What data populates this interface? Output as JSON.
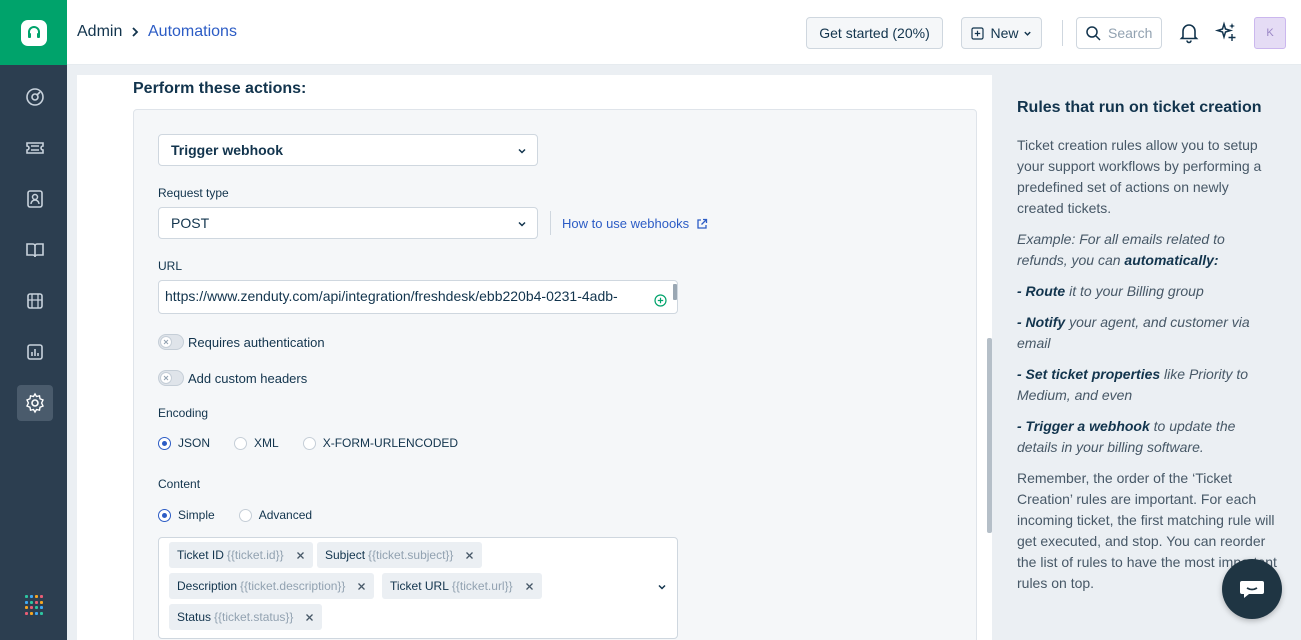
{
  "header": {
    "breadcrumb_root": "Admin",
    "breadcrumb_current": "Automations",
    "get_started_label": "Get started (20%)",
    "new_label": "New",
    "search_placeholder": "Search",
    "avatar_initial": "K"
  },
  "rail": {
    "items": [
      "dashboard-icon",
      "tickets-icon",
      "contacts-icon",
      "solutions-icon",
      "forums-icon",
      "reports-icon",
      "admin-gear-icon"
    ],
    "active": "admin-gear-icon",
    "brand_color": "#00a36b"
  },
  "main": {
    "section_title": "Perform these actions:",
    "action_select": "Trigger webhook",
    "request_type_label": "Request type",
    "request_type_value": "POST",
    "how_to_link": "How to use webhooks",
    "url_label": "URL",
    "url_value": "https://www.zenduty.com/api/integration/freshdesk/ebb220b4-0231-4adb-",
    "requires_auth_label": "Requires authentication",
    "requires_auth_on": false,
    "custom_headers_label": "Add custom headers",
    "custom_headers_on": false,
    "encoding_label": "Encoding",
    "encoding_options": [
      "JSON",
      "XML",
      "X-FORM-URLENCODED"
    ],
    "encoding_selected": "JSON",
    "content_label": "Content",
    "content_options": [
      "Simple",
      "Advanced"
    ],
    "content_selected": "Simple",
    "tags": [
      {
        "name": "Ticket ID",
        "placeholder": "{{ticket.id}}"
      },
      {
        "name": "Subject",
        "placeholder": "{{ticket.subject}}"
      },
      {
        "name": "Description",
        "placeholder": "{{ticket.description}}"
      },
      {
        "name": "Ticket URL",
        "placeholder": "{{ticket.url}}"
      },
      {
        "name": "Status",
        "placeholder": "{{ticket.status}}"
      }
    ]
  },
  "side": {
    "title": "Rules that run on ticket creation",
    "p1": "Ticket creation rules allow you to setup your support workflows by performing a predefined set of actions on newly created tickets.",
    "ex_prefix": "Example: For all emails related to refunds, you can ",
    "ex_bold": "automatically:",
    "b1_bold": "- Route",
    "b1_rest": " it to your Billing group",
    "b2_bold": "- Notify",
    "b2_rest": " your agent, and customer via email",
    "b3_bold": "- Set ticket properties",
    "b3_rest": " like Priority to Medium, and even",
    "b4_bold": "- Trigger a webhook",
    "b4_rest": " to update the details in your billing software.",
    "p_last": "Remember, the order of the ‘Ticket Creation’ rules are important. For each incoming ticket, the first matching rule will get executed, and stop. You can reorder the list of rules to have the most important rules on top."
  }
}
